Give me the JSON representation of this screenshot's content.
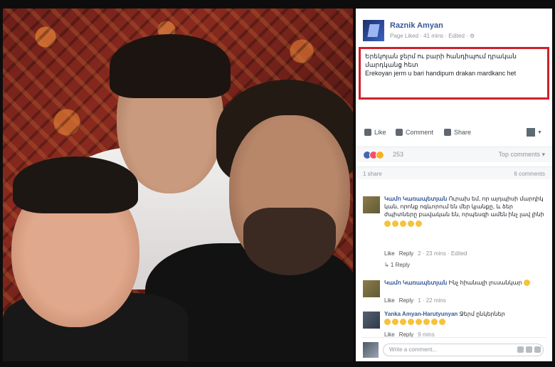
{
  "post": {
    "author": "Raznik Amyan",
    "meta": "Page Liked · 41 mins · Edited · ⚙",
    "text_line1": "Երեկոյան ջերմ ու բարի հանդիպում դրական մարդկանց հետ",
    "text_line2": "Erekoyan jerm u bari handipum drakan mardkanc het"
  },
  "actions": {
    "like": "Like",
    "comment": "Comment",
    "share": "Share"
  },
  "reactions": {
    "count": "253",
    "top_comments": "Top comments ▾"
  },
  "stats": {
    "shares": "1 share",
    "comments": "6 comments"
  },
  "comments": [
    {
      "author": "Կամո Կառապետյան",
      "text": "Ուրախ եմ, որ այդպիսի մարդիկ կան, որոնք ոգևորում են մեր կյանքը, և ձեր ժպիտները բավական են, որպեսզի ամեն ինչ լավ լինի",
      "emoji_count": 5,
      "meta_like": "Like",
      "meta_reply": "Reply",
      "meta_extra": "2 · 23 mins · Edited",
      "replies": "↳ 1 Reply"
    },
    {
      "author": "Կամո Կառապետյան",
      "text": "Ինչ հիանալի լուսանկար",
      "emoji_count": 1,
      "meta_like": "Like",
      "meta_reply": "Reply",
      "meta_extra": "1 · 22 mins"
    },
    {
      "author": "Yanka Amyan-Harutyunyan",
      "text": "Ջերմ ընկերներ",
      "emoji_count": 8,
      "meta_like": "Like",
      "meta_reply": "Reply",
      "meta_extra": "9 mins"
    }
  ],
  "comment_input": {
    "placeholder": "Write a comment..."
  },
  "colors": {
    "facebook_blue": "#365899",
    "highlight_red": "#d0202a"
  }
}
